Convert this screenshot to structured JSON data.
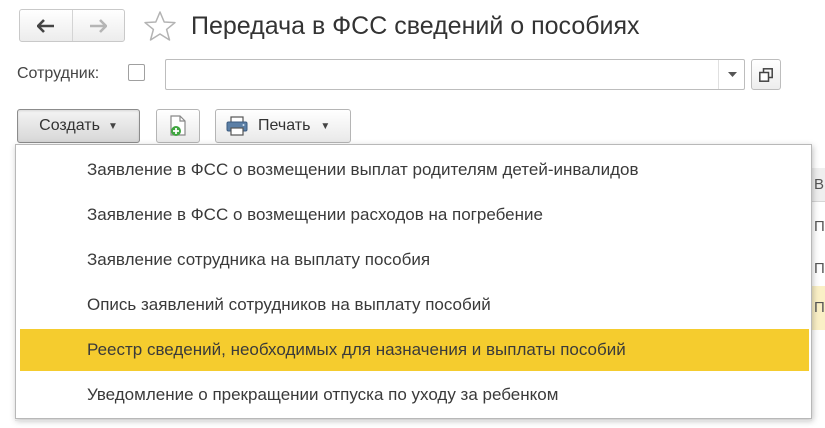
{
  "header": {
    "title": "Передача в ФСС сведений о пособиях",
    "back_icon": "arrow-left-icon",
    "forward_icon": "arrow-right-icon",
    "favorite_icon": "star-icon"
  },
  "employee": {
    "label": "Сотрудник:",
    "checked": false,
    "value": "",
    "placeholder": ""
  },
  "toolbar": {
    "create_label": "Создать",
    "add_icon": "add-document-icon",
    "print_label": "Печать",
    "print_icon": "printer-icon"
  },
  "create_menu": {
    "items": [
      {
        "label": "Заявление в ФСС о возмещении выплат родителям детей-инвалидов",
        "selected": false
      },
      {
        "label": "Заявление в ФСС о возмещении расходов на погребение",
        "selected": false
      },
      {
        "label": "Заявление сотрудника на выплату пособия",
        "selected": false
      },
      {
        "label": "Опись заявлений сотрудников на выплату пособий",
        "selected": false
      },
      {
        "label": "Реестр сведений, необходимых для назначения и выплаты пособий",
        "selected": true
      },
      {
        "label": "Уведомление о прекращении отпуска по уходу за ребенком",
        "selected": false
      }
    ]
  },
  "background_table": {
    "header_cell": "В",
    "cells": [
      "П",
      "П",
      "П"
    ]
  },
  "colors": {
    "selected_item": "#f5cc2e",
    "accent_green": "#4caf50"
  }
}
